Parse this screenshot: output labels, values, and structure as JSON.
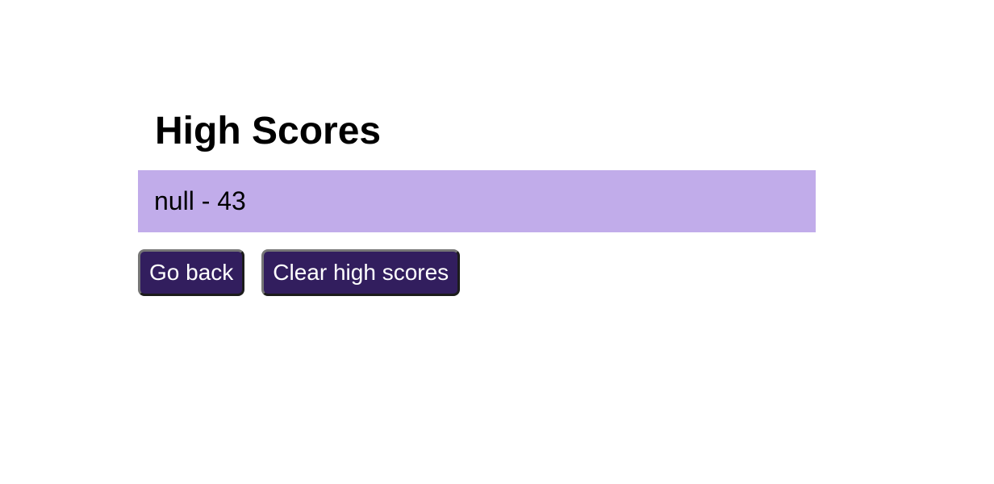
{
  "page": {
    "title": "High Scores"
  },
  "scores": [
    {
      "text": "null - 43"
    }
  ],
  "buttons": {
    "go_back_label": "Go back",
    "clear_label": "Clear high scores"
  },
  "colors": {
    "score_row_background": "#c1acea",
    "button_background": "#321e5e",
    "button_text": "#ffffff"
  }
}
